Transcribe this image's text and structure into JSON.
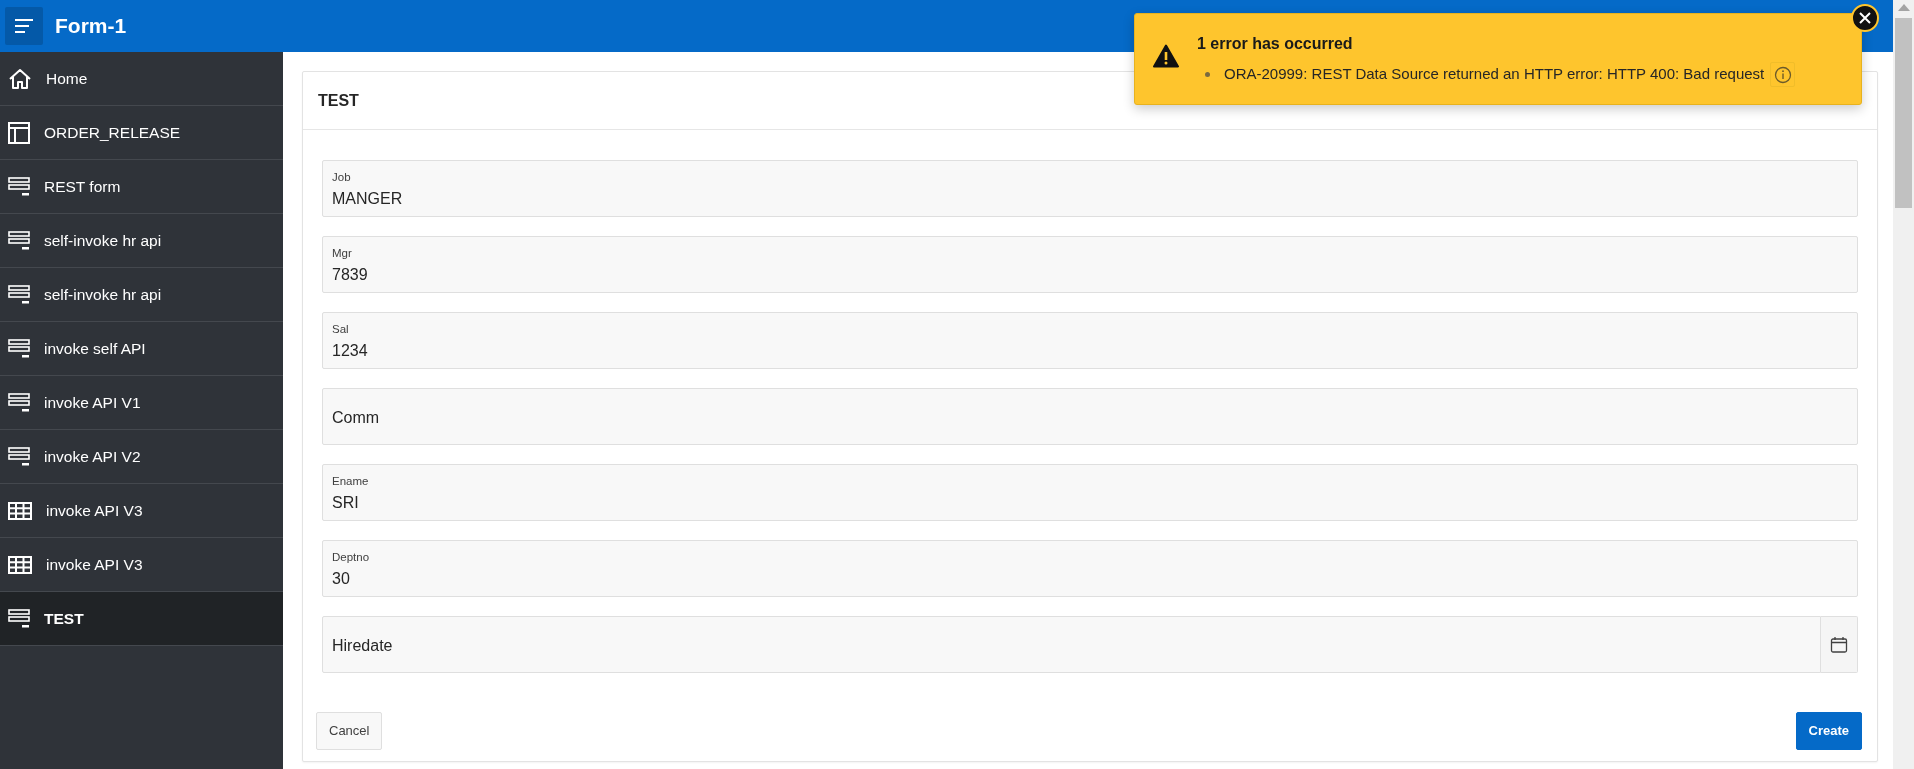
{
  "header": {
    "title": "Form-1"
  },
  "sidebar": {
    "items": [
      {
        "label": "Home",
        "kind": "home",
        "selected": false
      },
      {
        "label": "ORDER_RELEASE",
        "kind": "layout",
        "selected": false
      },
      {
        "label": "REST form",
        "kind": "form",
        "selected": false
      },
      {
        "label": "self-invoke hr api",
        "kind": "form",
        "selected": false
      },
      {
        "label": "self-invoke hr api",
        "kind": "form",
        "selected": false
      },
      {
        "label": "invoke self API",
        "kind": "form",
        "selected": false
      },
      {
        "label": "invoke API V1",
        "kind": "form",
        "selected": false
      },
      {
        "label": "invoke API V2",
        "kind": "form",
        "selected": false
      },
      {
        "label": "invoke API V3",
        "kind": "grid",
        "selected": false
      },
      {
        "label": "invoke API V3",
        "kind": "grid",
        "selected": false
      },
      {
        "label": "TEST",
        "kind": "form",
        "selected": true
      }
    ]
  },
  "region": {
    "title": "TEST",
    "fields": [
      {
        "label": "Job",
        "value": "MANGER",
        "kind": "text"
      },
      {
        "label": "Mgr",
        "value": "7839",
        "kind": "text"
      },
      {
        "label": "Sal",
        "value": "1234",
        "kind": "text"
      },
      {
        "label": "Comm",
        "kind": "text"
      },
      {
        "label": "Ename",
        "value": "SRI",
        "kind": "text"
      },
      {
        "label": "Deptno",
        "value": "30",
        "kind": "text"
      },
      {
        "label": "Hiredate",
        "kind": "date"
      }
    ],
    "buttons": [
      {
        "label": "Cancel",
        "kind": "secondary"
      },
      {
        "label": "Create",
        "kind": "primary"
      }
    ]
  },
  "notification": {
    "title": "1 error has occurred",
    "messages": [
      "ORA-20999: REST Data Source returned an HTTP error: HTTP 400: Bad request"
    ]
  }
}
